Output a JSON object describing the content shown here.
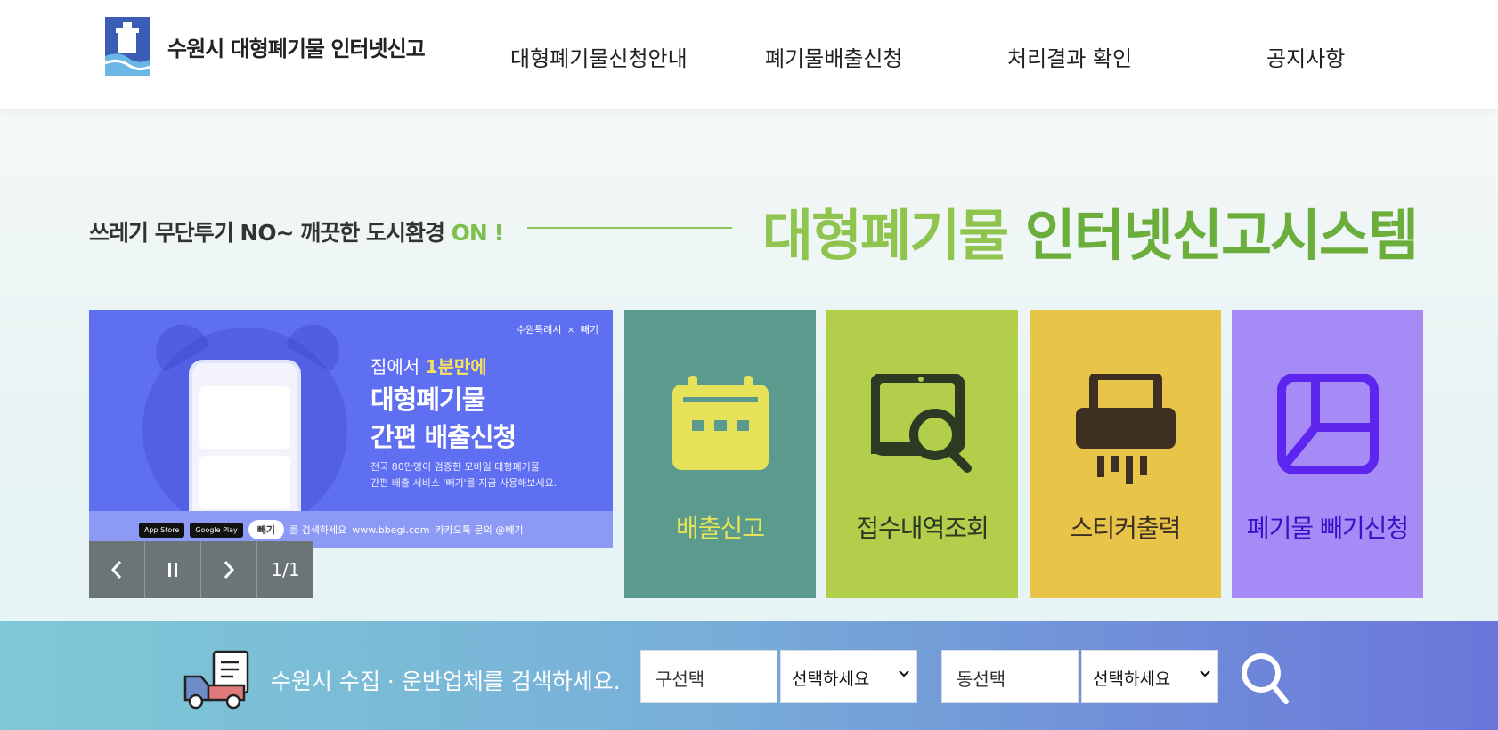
{
  "header": {
    "site_title": "수원시 대형폐기물 인터넷신고",
    "nav": [
      {
        "label": "대형폐기물신청안내"
      },
      {
        "label": "폐기물배출신청"
      },
      {
        "label": "처리결과 확인"
      },
      {
        "label": "공지사항"
      }
    ]
  },
  "hero": {
    "slogan_main": "쓰레기 무단투기 NO~ 깨끗한 도시환경",
    "slogan_accent": "ON !",
    "title_part1": "대형폐기물",
    "title_part2": "인터넷신고시스템"
  },
  "banner": {
    "brand_left": "수원특례시",
    "brand_x": "×",
    "brand_right": "빼기",
    "head_pre": "집에서",
    "head_highlight": "1분만에",
    "title_line1": "대형폐기물",
    "title_line2": "간편 배출신청",
    "desc_line1": "전국 80만명이 검증한 모바일 대형폐기물",
    "desc_line2": "간편 배출 서비스 '빼기'를 지금 사용해보세요.",
    "app_store": "App Store",
    "google_play": "Google Play",
    "search_word": "빼기",
    "search_suffix": "를 검색하세요",
    "site_url": "www.bbegi.com",
    "kakao": "카카오톡 문의 @빼기",
    "counter": "1/1"
  },
  "tiles": [
    {
      "label": "배출신고",
      "bg": "#5a9b8e",
      "label_color": "#e6e25a"
    },
    {
      "label": "접수내역조회",
      "bg": "#b2ce4a",
      "label_color": "#2d3a23"
    },
    {
      "label": "스티커출력",
      "bg": "#e8c548",
      "label_color": "#3d2f22"
    },
    {
      "label": "폐기물 빼기신청",
      "bg": "#a68bf6",
      "label_color": "#3b10c9"
    }
  ],
  "search_bar": {
    "text": "수원시 수집 · 운반업체를 검색하세요.",
    "gu_label": "구선택",
    "gu_value": "선택하세요",
    "dong_label": "동선택",
    "dong_value": "선택하세요"
  }
}
